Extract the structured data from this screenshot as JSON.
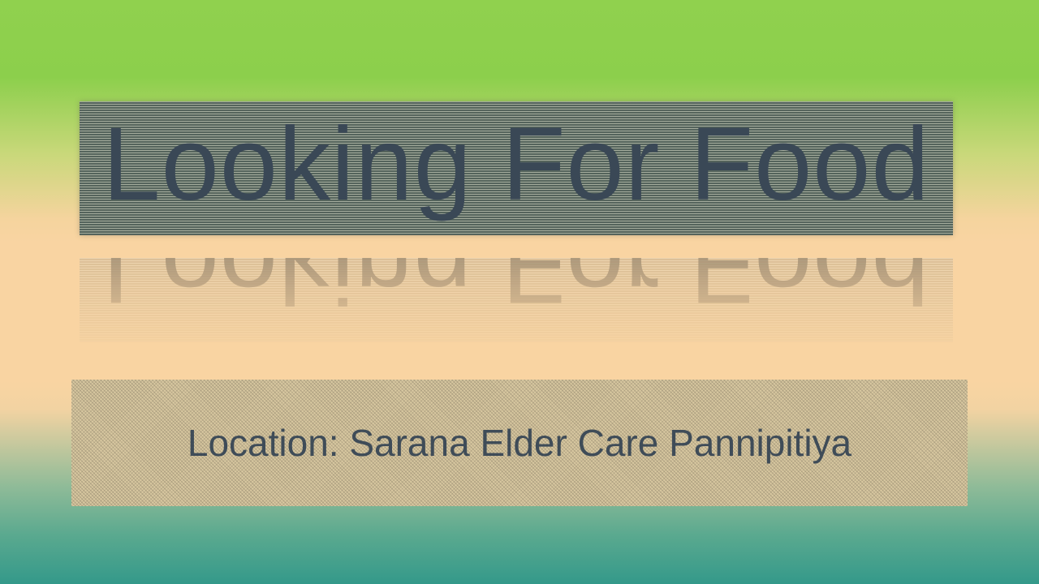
{
  "slide": {
    "title": "Looking For Food",
    "subtitle": "Location: Sarana Elder Care Pannipitiya"
  },
  "colors": {
    "title_text": "#3a4856",
    "subtitle_text": "#3f4c58",
    "background_top": "#90d14e",
    "background_middle": "#f9d4a2",
    "background_bottom": "#34998a"
  }
}
